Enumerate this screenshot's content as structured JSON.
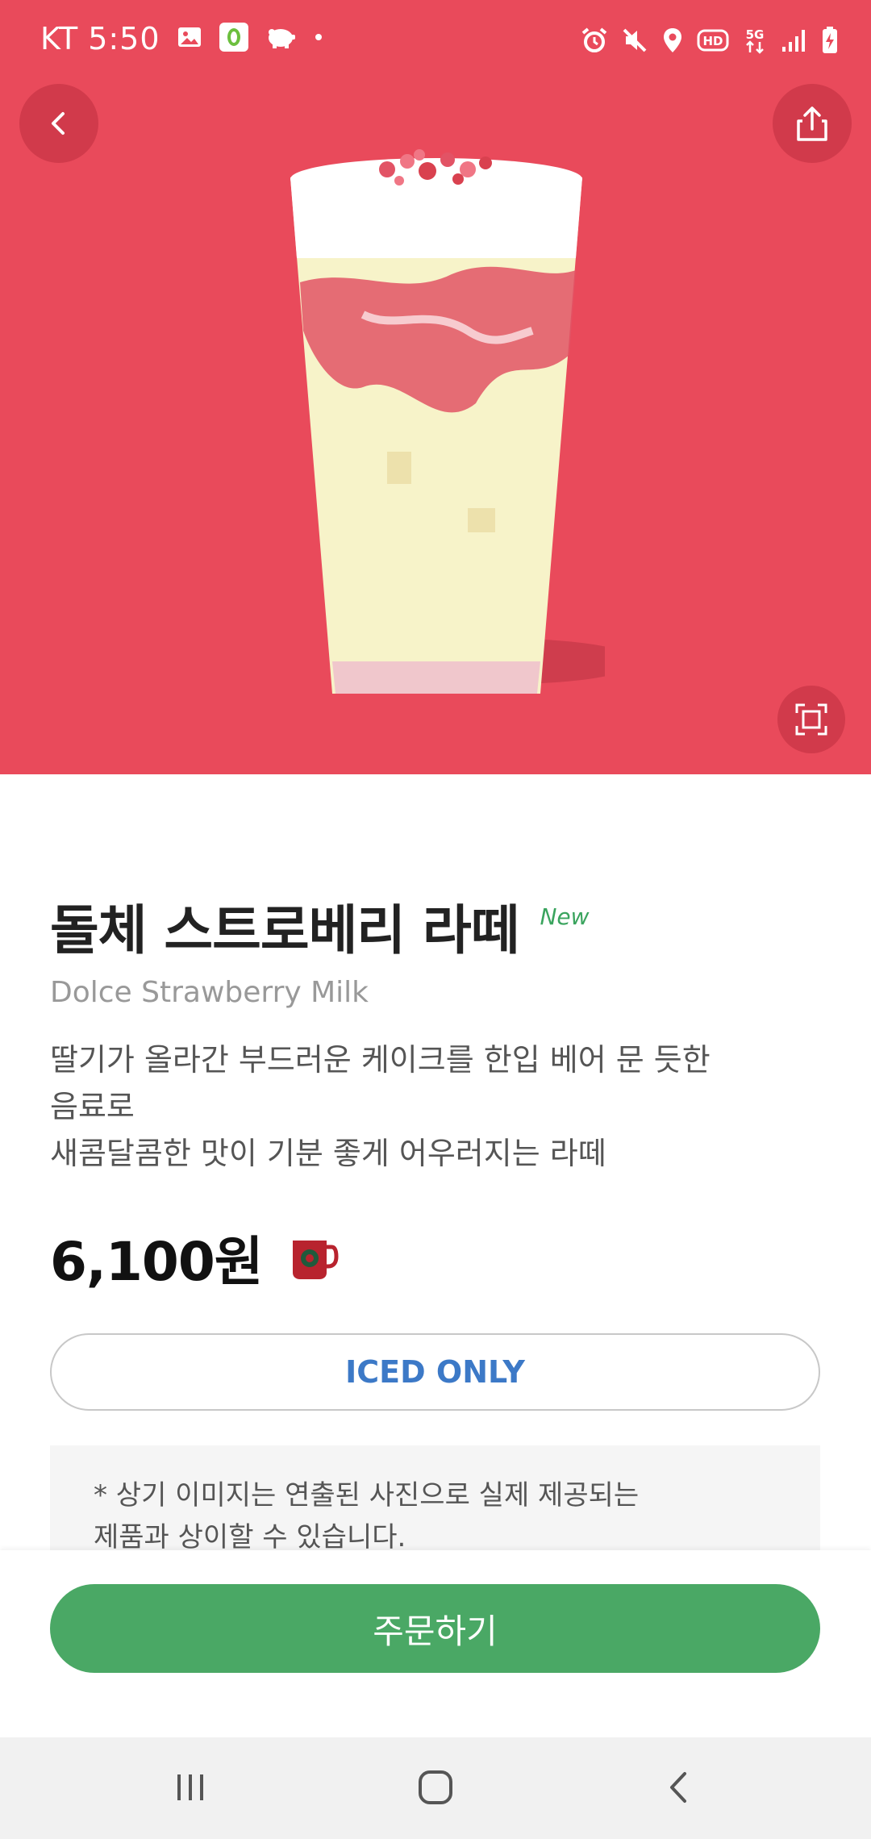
{
  "status_bar": {
    "carrier": "KT",
    "time": "5:50",
    "left_icons": [
      "gallery-icon",
      "app-o-icon",
      "piggy-bank-icon",
      "notification-dot-icon"
    ],
    "right_icons": [
      "alarm-icon",
      "mute-icon",
      "location-icon",
      "hd-icon",
      "5g-icon",
      "signal-icon",
      "battery-icon"
    ]
  },
  "hero": {
    "background_color": "#e94a5b",
    "image_subject": "dolce-strawberry-latte-drink"
  },
  "product": {
    "name_ko": "돌체 스트로베리 라떼",
    "badge": "New",
    "name_en": "Dolce Strawberry Milk",
    "description_line1": "딸기가 올라간 부드러운 케이크를 한입 베어 문 듯한",
    "description_line2": "음료로",
    "description_line3": "새콤달콤한 맛이 기분 좋게 어우러지는 라떼",
    "price": "6,100원",
    "temperature_option": "ICED ONLY",
    "notice_line1": "* 상기 이미지는 연출된 사진으로 실제 제공되는",
    "notice_line2": "제품과 상이할 수 있습니다."
  },
  "actions": {
    "order_label": "주문하기"
  },
  "colors": {
    "accent_green": "#4aa865",
    "badge_green": "#3aa45e",
    "option_blue": "#3c79c7"
  }
}
